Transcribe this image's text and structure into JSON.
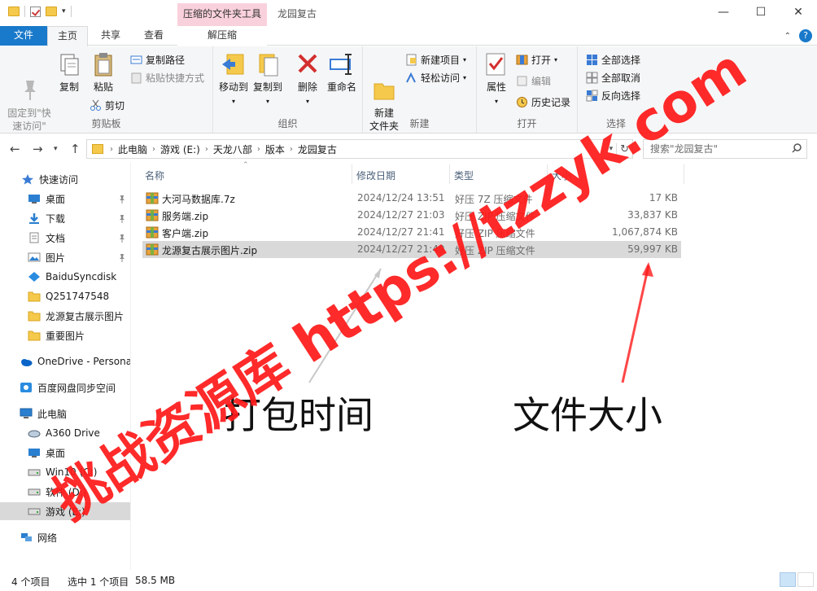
{
  "titlebar": {
    "context_tool": "压缩的文件夹工具",
    "window_title": "龙园复古",
    "minimize": "—",
    "maximize": "☐",
    "close": "✕"
  },
  "tabs": {
    "file": "文件",
    "home": "主页",
    "share": "共享",
    "view": "查看",
    "extract": "解压缩"
  },
  "ribbon": {
    "clipboard": {
      "label": "剪贴板",
      "pin_quick_access": "固定到\"快\n速访问\"",
      "copy": "复制",
      "paste": "粘贴",
      "copy_path": "复制路径",
      "paste_shortcut": "粘贴快捷方式",
      "cut": "剪切"
    },
    "organize": {
      "label": "组织",
      "move_to": "移动到",
      "copy_to": "复制到",
      "delete": "删除",
      "rename": "重命名"
    },
    "new": {
      "label": "新建",
      "new_folder": "新建\n文件夹",
      "new_item": "新建项目",
      "easy_access": "轻松访问"
    },
    "open": {
      "label": "打开",
      "properties": "属性",
      "open": "打开",
      "edit": "编辑",
      "history": "历史记录"
    },
    "select": {
      "label": "选择",
      "select_all": "全部选择",
      "select_none": "全部取消",
      "invert": "反向选择"
    }
  },
  "address": {
    "crumbs": [
      "此电脑",
      "游戏 (E:)",
      "天龙八部",
      "版本",
      "龙园复古"
    ],
    "search_placeholder": "搜索\"龙园复古\""
  },
  "nav": {
    "quick_access": "快速访问",
    "items": [
      {
        "label": "桌面",
        "pinned": true
      },
      {
        "label": "下载",
        "pinned": true
      },
      {
        "label": "文档",
        "pinned": true
      },
      {
        "label": "图片",
        "pinned": true
      },
      {
        "label": "BaiduSyncdisk",
        "pinned": false
      },
      {
        "label": "Q251747548",
        "pinned": false
      },
      {
        "label": "龙源复古展示图片",
        "pinned": false
      },
      {
        "label": "重要图片",
        "pinned": false
      }
    ],
    "onedrive": "OneDrive - Persona",
    "baidu": "百度网盘同步空间",
    "this_pc": "此电脑",
    "pc_items": [
      "A360 Drive",
      "桌面",
      "Win10 (C:)",
      "软件 (D:)",
      "游戏 (E:)"
    ],
    "network": "网络"
  },
  "columns": {
    "name": "名称",
    "modified": "修改日期",
    "type": "类型",
    "size": "大小"
  },
  "files": [
    {
      "name": "大河马数据库.7z",
      "date": "2024/12/24 13:51",
      "type": "好压 7Z 压缩文件",
      "size": "17 KB"
    },
    {
      "name": "服务端.zip",
      "date": "2024/12/27 21:03",
      "type": "好压 ZIP 压缩文件",
      "size": "33,837 KB"
    },
    {
      "name": "客户端.zip",
      "date": "2024/12/27 21:41",
      "type": "好压 ZIP 压缩文件",
      "size": "1,067,874 KB"
    },
    {
      "name": "龙源复古展示图片.zip",
      "date": "2024/12/27 21:49",
      "type": "好压 ZIP 压缩文件",
      "size": "59,997 KB"
    }
  ],
  "status": {
    "count": "4 个项目",
    "selected": "选中 1 个项目",
    "size": "58.5 MB"
  },
  "annotations": {
    "pack_time": "打包时间",
    "file_size": "文件大小"
  },
  "watermark": {
    "text": "挑战资源库 https://tzzyk.com"
  },
  "colors": {
    "accent": "#1979ca",
    "context_tab": "#f9d1dc",
    "watermark": "#ff1a1a",
    "selection": "#d9d9d9"
  }
}
